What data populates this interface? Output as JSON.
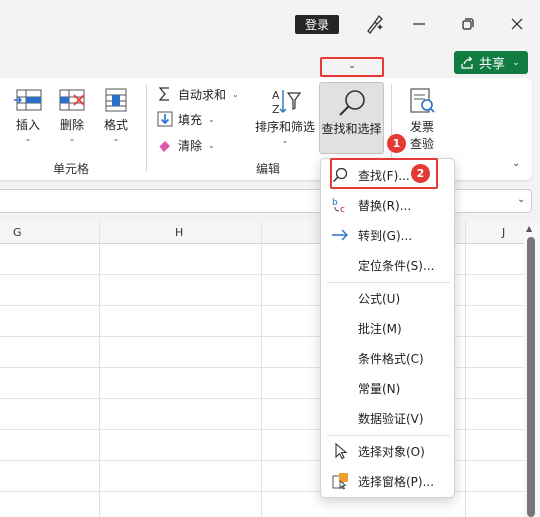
{
  "titlebar": {
    "login_label": "登录"
  },
  "share": {
    "label": "共享"
  },
  "ribbon": {
    "cells_group": {
      "label": "单元格",
      "insert": "插入",
      "delete": "删除",
      "format": "格式"
    },
    "edit_group": {
      "label": "编辑",
      "autosum": "自动求和",
      "fill": "填充",
      "clear": "清除",
      "sort_filter": "排序和筛选",
      "find_select": "查找和选择"
    },
    "invoice_group": {
      "line1": "发票",
      "line2": "查验"
    }
  },
  "columns": [
    "G",
    "H",
    "J"
  ],
  "badges": {
    "first": "1",
    "second": "2"
  },
  "menu": {
    "items": [
      {
        "label": "查找(F)...",
        "icon": "search-icon"
      },
      {
        "label": "替换(R)...",
        "icon": "replace-icon"
      },
      {
        "label": "转到(G)...",
        "icon": "arrow-right-icon"
      },
      {
        "label": "定位条件(S)...",
        "icon": ""
      },
      {
        "label": "公式(U)",
        "icon": ""
      },
      {
        "label": "批注(M)",
        "icon": ""
      },
      {
        "label": "条件格式(C)",
        "icon": ""
      },
      {
        "label": "常量(N)",
        "icon": ""
      },
      {
        "label": "数据验证(V)",
        "icon": ""
      },
      {
        "label": "选择对象(O)",
        "icon": "pointer-icon"
      },
      {
        "label": "选择窗格(P)...",
        "icon": "selection-pane-icon"
      }
    ]
  },
  "colors": {
    "accent_green": "#107c41",
    "highlight_red": "#e53935",
    "blue_icon": "#2a6fc9"
  }
}
